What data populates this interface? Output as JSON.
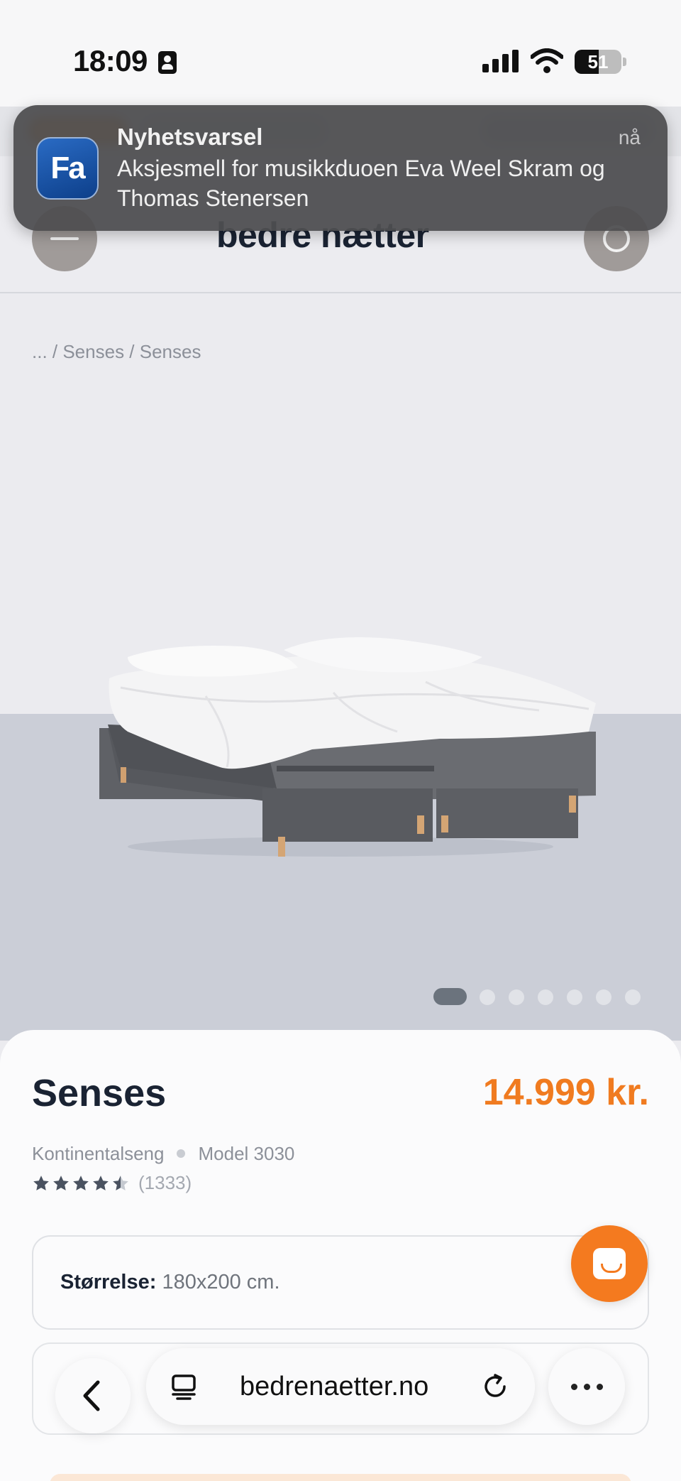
{
  "status_bar": {
    "time": "18:09",
    "battery": "51",
    "battery_level": 0.51
  },
  "notification": {
    "app_icon_label": "Fa",
    "title": "Nyhetsvarsel",
    "time": "nå",
    "body": "Aksjesmell for musikkduoen Eva Weel Skram og Thomas Stenersen"
  },
  "header": {
    "logo": "bedre nætter"
  },
  "breadcrumb": "... / Senses / Senses",
  "gallery": {
    "total_images": 7,
    "active_index": 0
  },
  "product": {
    "name": "Senses",
    "price": "14.999 kr.",
    "category": "Kontinentalseng",
    "model": "Model 3030",
    "rating": 4.5,
    "reviews": "(1333)",
    "size_label": "Størrelse:",
    "size_value": "180x200 cm."
  },
  "browser": {
    "url": "bedrenaetter.no"
  },
  "colors": {
    "accent": "#f07b20",
    "text": "#1a2333",
    "muted": "#8c9099"
  }
}
